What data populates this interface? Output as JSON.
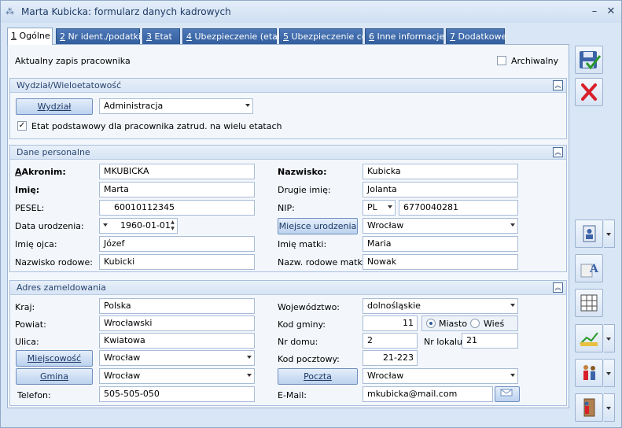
{
  "window": {
    "title": "Marta Kubicka: formularz danych kadrowych"
  },
  "tabs": [
    {
      "key": "1",
      "label": " Ogólne"
    },
    {
      "key": "2",
      "label": " Nr ident./podatki"
    },
    {
      "key": "3",
      "label": " Etat"
    },
    {
      "key": "4",
      "label": " Ubezpieczenie (etat)"
    },
    {
      "key": "5",
      "label": " Ubezpieczenie cd"
    },
    {
      "key": "6",
      "label": " Inne informacje"
    },
    {
      "key": "7",
      "label": " Dodatkowe"
    }
  ],
  "top": {
    "current_record": "Aktualny zapis pracownika",
    "archived": "Archiwalny"
  },
  "wydzial": {
    "header": "Wydział/Wieloetatowość",
    "button": "Wydział",
    "value": "Administracja",
    "main_job_label": "Etat podstawowy dla pracownika zatrud. na wielu etatach"
  },
  "personal": {
    "header": "Dane personalne",
    "akronim_label": "Akronim:",
    "akronim": "MKUBICKA",
    "nazwisko_label": "Nazwisko:",
    "nazwisko": "Kubicka",
    "imie_label": "Imię:",
    "imie": "Marta",
    "drugie_imie_label": "Drugie imię:",
    "drugie_imie": "Jolanta",
    "pesel_label": "PESEL:",
    "pesel": "60010112345",
    "nip_label": "NIP:",
    "nip_prefix": "PL",
    "nip": "6770040281",
    "data_ur_label": "Data urodzenia:",
    "data_ur": "1960-01-01",
    "miejsce_ur_button": "Miejsce urodzenia",
    "miejsce_ur": "Wrocław",
    "imie_ojca_label": "Imię ojca:",
    "imie_ojca": "Józef",
    "imie_matki_label": "Imię matki:",
    "imie_matki": "Maria",
    "nazwisko_rod_label": "Nazwisko rodowe:",
    "nazwisko_rod": "Kubicki",
    "nazw_rod_matki_label": "Nazw. rodowe matki:",
    "nazw_rod_matki": "Nowak"
  },
  "address": {
    "header": "Adres zameldowania",
    "kraj_label": "Kraj:",
    "kraj": "Polska",
    "woj_label": "Województwo:",
    "woj": "dolnośląskie",
    "powiat_label": "Powiat:",
    "powiat": "Wrocławski",
    "kod_gminy_label": "Kod gminy:",
    "kod_gminy": "11",
    "miasto": "Miasto",
    "wies": "Wieś",
    "ulica_label": "Ulica:",
    "ulica": "Kwiatowa",
    "nr_domu_label": "Nr domu:",
    "nr_domu": "2",
    "nr_lokalu_label": "Nr lokalu:",
    "nr_lokalu": "21",
    "miejscowosc_button": "Miejscowość",
    "miejscowosc": "Wrocław",
    "kod_poczt_label": "Kod pocztowy:",
    "kod_poczt": "21-223",
    "gmina_button": "Gmina",
    "gmina": "Wrocław",
    "poczta_button": "Poczta",
    "poczta": "Wrocław",
    "telefon_label": "Telefon:",
    "telefon": "505-505-050",
    "email_label": "E-Mail:",
    "email": "mkubicka@mail.com"
  },
  "colors": {
    "accent": "#335e9e",
    "panel": "#f3f7fc",
    "window": "#d9e6f5"
  }
}
